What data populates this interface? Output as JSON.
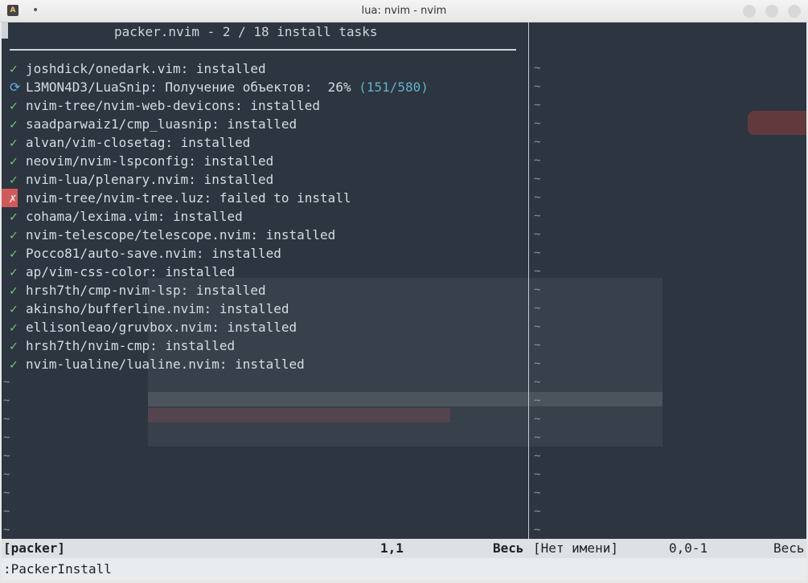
{
  "window": {
    "title": "lua: nvim - nvim",
    "app_icon_letter": "A"
  },
  "packer": {
    "header": "packer.nvim - 2 / 18 install tasks",
    "tasks": [
      {
        "status": "ok",
        "mark": "✓",
        "text": "joshdick/onedark.vim: installed"
      },
      {
        "status": "progress",
        "mark": "⟳",
        "text": "L3MON4D3/LuaSnip: Получение объектов:  26% ",
        "extra": "(151/580)"
      },
      {
        "status": "ok",
        "mark": "✓",
        "text": "nvim-tree/nvim-web-devicons: installed"
      },
      {
        "status": "ok",
        "mark": "✓",
        "text": "saadparwaiz1/cmp_luasnip: installed"
      },
      {
        "status": "ok",
        "mark": "✓",
        "text": "alvan/vim-closetag: installed"
      },
      {
        "status": "ok",
        "mark": "✓",
        "text": "neovim/nvim-lspconfig: installed"
      },
      {
        "status": "ok",
        "mark": "✓",
        "text": "nvim-lua/plenary.nvim: installed"
      },
      {
        "status": "fail",
        "mark": "✗",
        "text": "nvim-tree/nvim-tree.luz: failed to install"
      },
      {
        "status": "ok",
        "mark": "✓",
        "text": "cohama/lexima.vim: installed"
      },
      {
        "status": "ok",
        "mark": "✓",
        "text": "nvim-telescope/telescope.nvim: installed"
      },
      {
        "status": "ok",
        "mark": "✓",
        "text": "Pocco81/auto-save.nvim: installed"
      },
      {
        "status": "ok",
        "mark": "✓",
        "text": "ap/vim-css-color: installed"
      },
      {
        "status": "ok",
        "mark": "✓",
        "text": "hrsh7th/cmp-nvim-lsp: installed"
      },
      {
        "status": "ok",
        "mark": "✓",
        "text": "akinsho/bufferline.nvim: installed"
      },
      {
        "status": "ok",
        "mark": "✓",
        "text": "ellisonleao/gruvbox.nvim: installed"
      },
      {
        "status": "ok",
        "mark": "✓",
        "text": "hrsh7th/nvim-cmp: installed"
      },
      {
        "status": "ok",
        "mark": "✓",
        "text": "nvim-lualine/lualine.nvim: installed"
      }
    ],
    "empty_line_marker": "~"
  },
  "statusline": {
    "left_name": "[packer]",
    "left_pos": "1,1",
    "left_scroll": "Весь",
    "right_name": "[Нет имени]",
    "right_pos": "0,0-1",
    "right_scroll": "Весь"
  },
  "cmdline": {
    "text": ":PackerInstall"
  },
  "colors": {
    "background": "#2c3540",
    "ok": "#6fcf74",
    "progress": "#5fb3e0",
    "fail": "#d05a5a"
  }
}
